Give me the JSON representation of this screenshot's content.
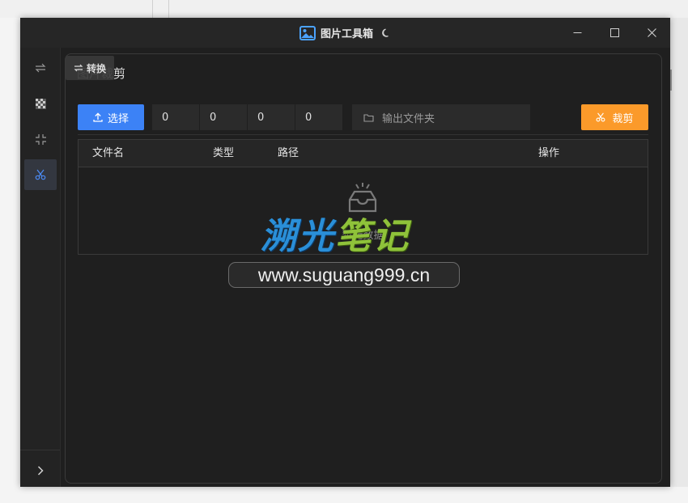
{
  "window": {
    "title": "图片工具箱"
  },
  "sidebar": {
    "items": [
      {
        "name": "convert",
        "icon": "swap-arrows-icon"
      },
      {
        "name": "mosaic",
        "icon": "checkerboard-icon"
      },
      {
        "name": "compress",
        "icon": "shrink-icon"
      },
      {
        "name": "crop",
        "icon": "scissors-icon",
        "active": true
      }
    ],
    "collapse_icon": "chevron-right-icon"
  },
  "tooltip": {
    "label": "转换"
  },
  "page": {
    "title": "图片裁剪"
  },
  "toolbar": {
    "select_label": "选择",
    "values": [
      "0",
      "0",
      "0",
      "0"
    ],
    "output_placeholder": "输出文件夹",
    "crop_label": "裁剪"
  },
  "table": {
    "headers": [
      "文件名",
      "类型",
      "路径",
      "操作"
    ],
    "empty_text": "暂无数据"
  },
  "watermark": {
    "logo_part1": "溯光",
    "logo_part2": "笔记",
    "url": "www.suguang999.cn"
  },
  "colors": {
    "primary": "#3c82f6",
    "accent": "#fb9a2a",
    "background": "#1f1f1f"
  }
}
